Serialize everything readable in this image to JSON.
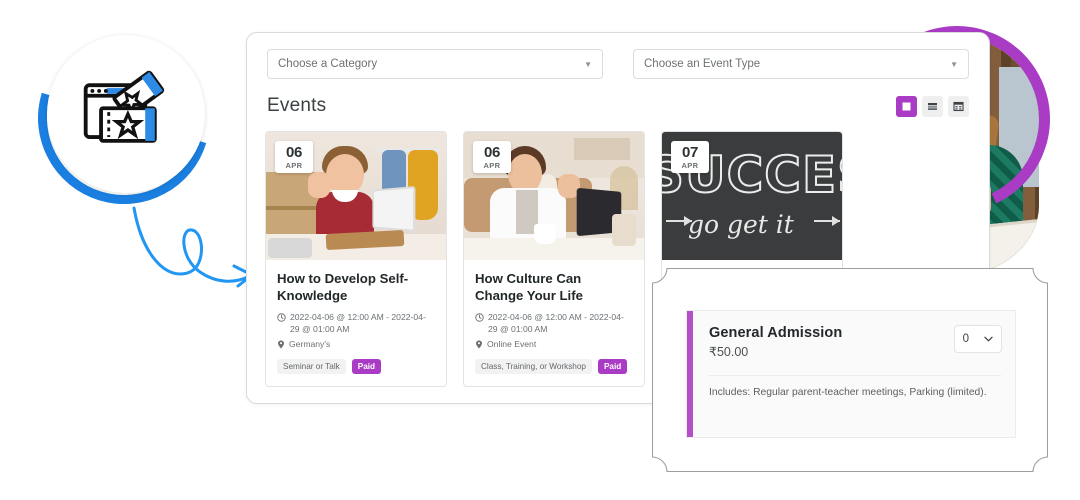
{
  "logo": {
    "name": "event-ticket-logo",
    "ring_color": "#1a7fe0"
  },
  "arrow": {
    "name": "curved-pointer-arrow",
    "color": "#2196f3"
  },
  "photo": {
    "name": "student-thumbs-up-photo",
    "ring_color": "#a93bc4"
  },
  "filters": {
    "category": {
      "value": "Choose a Category",
      "caret": "chevron-down-icon"
    },
    "event_type": {
      "value": "Choose an Event Type",
      "caret": "chevron-down-icon"
    }
  },
  "events": {
    "heading": "Events",
    "view_toggle": [
      {
        "icon": "grid-view-icon",
        "active": true
      },
      {
        "icon": "list-view-icon",
        "active": false
      },
      {
        "icon": "calendar-view-icon",
        "active": false
      }
    ],
    "accent_color": "#a93bc4",
    "cards": [
      {
        "day": "06",
        "month": "APR",
        "title": "How to Develop Self-Knowledge",
        "datetime": "2022-04-06 @ 12:00 AM - 2022-04-29 @ 01:00 AM",
        "location": "Germany's",
        "tags": [
          "Seminar or Talk"
        ],
        "paid_label": "Paid",
        "image_alt": "child-waving-at-laptop"
      },
      {
        "day": "06",
        "month": "APR",
        "title": "How Culture Can Change Your Life",
        "datetime": "2022-04-06 @ 12:00 AM - 2022-04-29 @ 01:00 AM",
        "location": "Online Event",
        "tags": [
          "Class, Training, or Workshop"
        ],
        "paid_label": "Paid",
        "image_alt": "woman-on-video-call"
      },
      {
        "day": "07",
        "month": "APR",
        "title": "",
        "datetime": "",
        "location": "",
        "tags": [],
        "paid_label": "",
        "image_alt": "chalkboard-success-go-get-it",
        "chalk_main": "SUCCESS",
        "chalk_sub": "go get it"
      }
    ]
  },
  "ticket": {
    "name": "General Admission",
    "price": "₹50.00",
    "quantity": "0",
    "quantity_caret": "chevron-down-icon",
    "includes": "Includes: Regular parent-teacher meetings, Parking (limited).",
    "accent_color": "#b44ec9"
  }
}
